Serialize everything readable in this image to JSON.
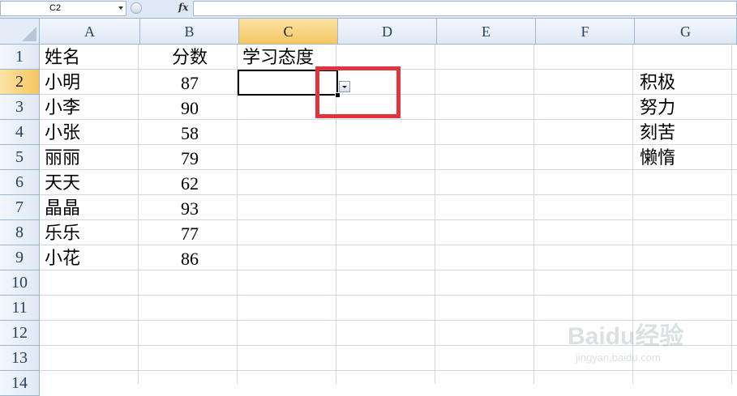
{
  "formula_bar": {
    "name_box": "C2",
    "fx_label": "fx",
    "formula": ""
  },
  "columns": [
    "A",
    "B",
    "C",
    "D",
    "E",
    "F",
    "G"
  ],
  "rows": [
    "1",
    "2",
    "3",
    "4",
    "5",
    "6",
    "7",
    "8",
    "9",
    "10",
    "11",
    "12",
    "13",
    "14"
  ],
  "selected_cell": {
    "column": "C",
    "row": "2"
  },
  "cells": {
    "names": [
      "姓名",
      "小明",
      "小李",
      "小张",
      "丽丽",
      "天天",
      "晶晶",
      "乐乐",
      "小花"
    ],
    "scores": [
      "分数",
      "87",
      "90",
      "58",
      "79",
      "62",
      "93",
      "77",
      "86"
    ],
    "attitude_header": "学习态度",
    "attitude_options": [
      "积极",
      "努力",
      "刻苦",
      "懒惰"
    ]
  },
  "watermark": {
    "brand": "Baidu经验",
    "url": "jingyan.baidu.com"
  },
  "colors": {
    "highlight_box": "#e0353b",
    "selected_header": "#f6c661",
    "grid_line": "#d0d7e5"
  }
}
